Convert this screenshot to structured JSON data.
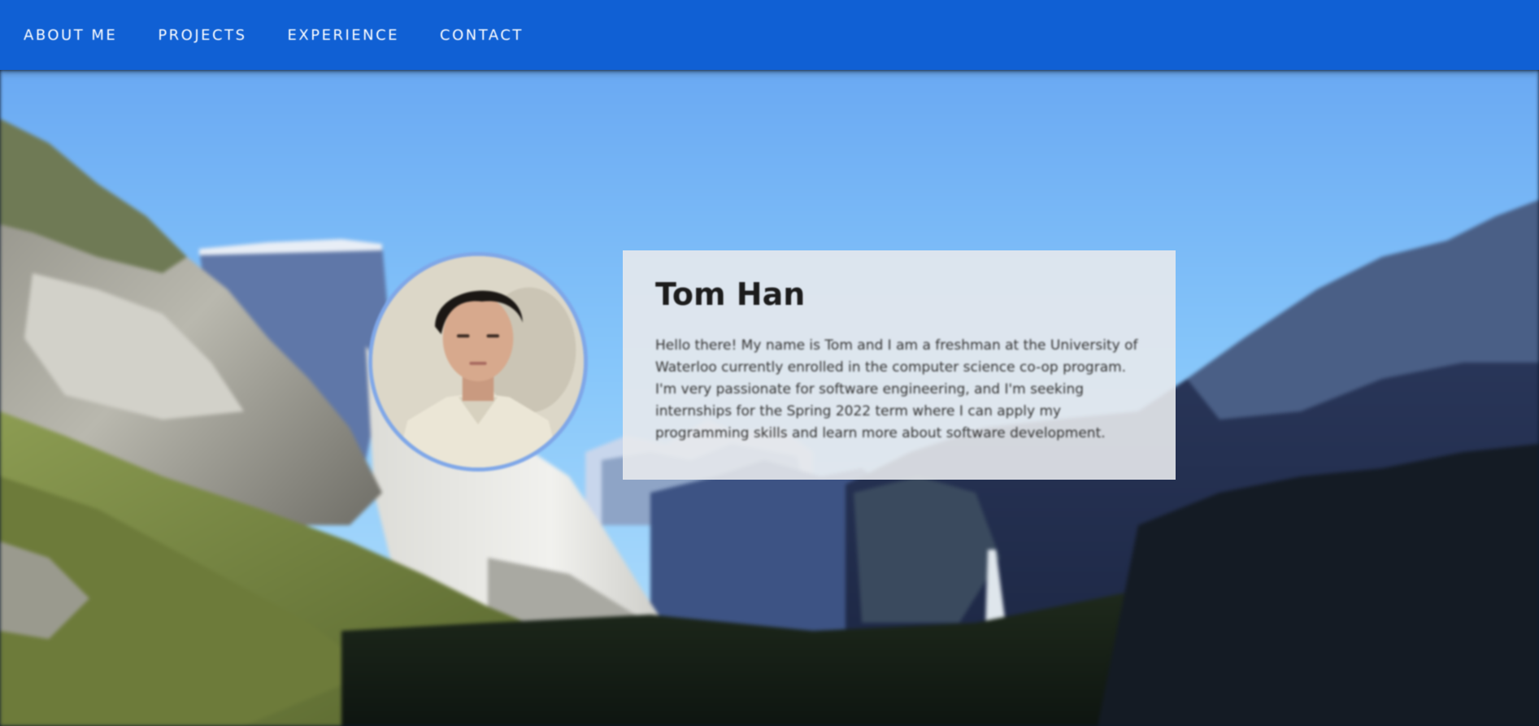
{
  "nav": {
    "items": [
      {
        "label": "ABOUT ME"
      },
      {
        "label": "PROJECTS"
      },
      {
        "label": "EXPERIENCE"
      },
      {
        "label": "CONTACT"
      }
    ]
  },
  "profile": {
    "name": "Tom Han",
    "bio": "Hello there! My name is Tom and I am a freshman at the University of Waterloo currently enrolled in the computer science co-op program. I'm very passionate for software engineering, and I'm seeking internships for the Spring 2022 term where I can apply my programming skills and learn more about software development."
  },
  "colors": {
    "nav_bg": "#1060d4",
    "nav_text": "#ffffff",
    "card_bg": "#e7e9ec",
    "avatar_border": "#7fa7e8"
  },
  "icons": {
    "background": "mountain-valley-photo",
    "avatar": "profile-photo"
  }
}
